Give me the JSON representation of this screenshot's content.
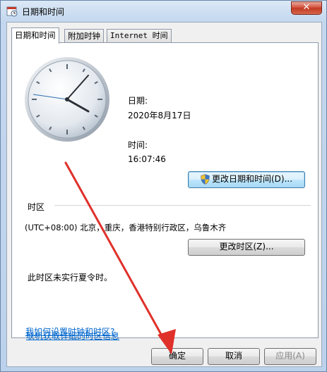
{
  "window": {
    "title": "日期和时间",
    "close_label": "✕"
  },
  "tabs": [
    {
      "label": "日期和时间",
      "active": true
    },
    {
      "label": "附加时钟",
      "active": false
    },
    {
      "label": "Internet 时间",
      "active": false
    }
  ],
  "datetime": {
    "date_label": "日期:",
    "date_value": "2020年8月17日",
    "time_label": "时间:",
    "time_value": "16:07:46",
    "change_button": "更改日期和时间(D)..."
  },
  "timezone": {
    "section_label": "时区",
    "value": "(UTC+08:00) 北京，重庆，香港特别行政区，乌鲁木齐",
    "change_button": "更改时区(Z)...",
    "dst_note": "此时区未实行夏令时。"
  },
  "links": {
    "online_info": "联机获取详细的时区信息",
    "how_to": "我如何设置时钟和时区?"
  },
  "footer": {
    "ok": "确定",
    "cancel": "取消",
    "apply": "应用(A)"
  },
  "colors": {
    "annotation_arrow": "#e0302a",
    "link": "#0066cc"
  },
  "icons": [
    "calendar-clock-icon",
    "close-icon",
    "clock-face-icon",
    "uac-shield-icon"
  ]
}
